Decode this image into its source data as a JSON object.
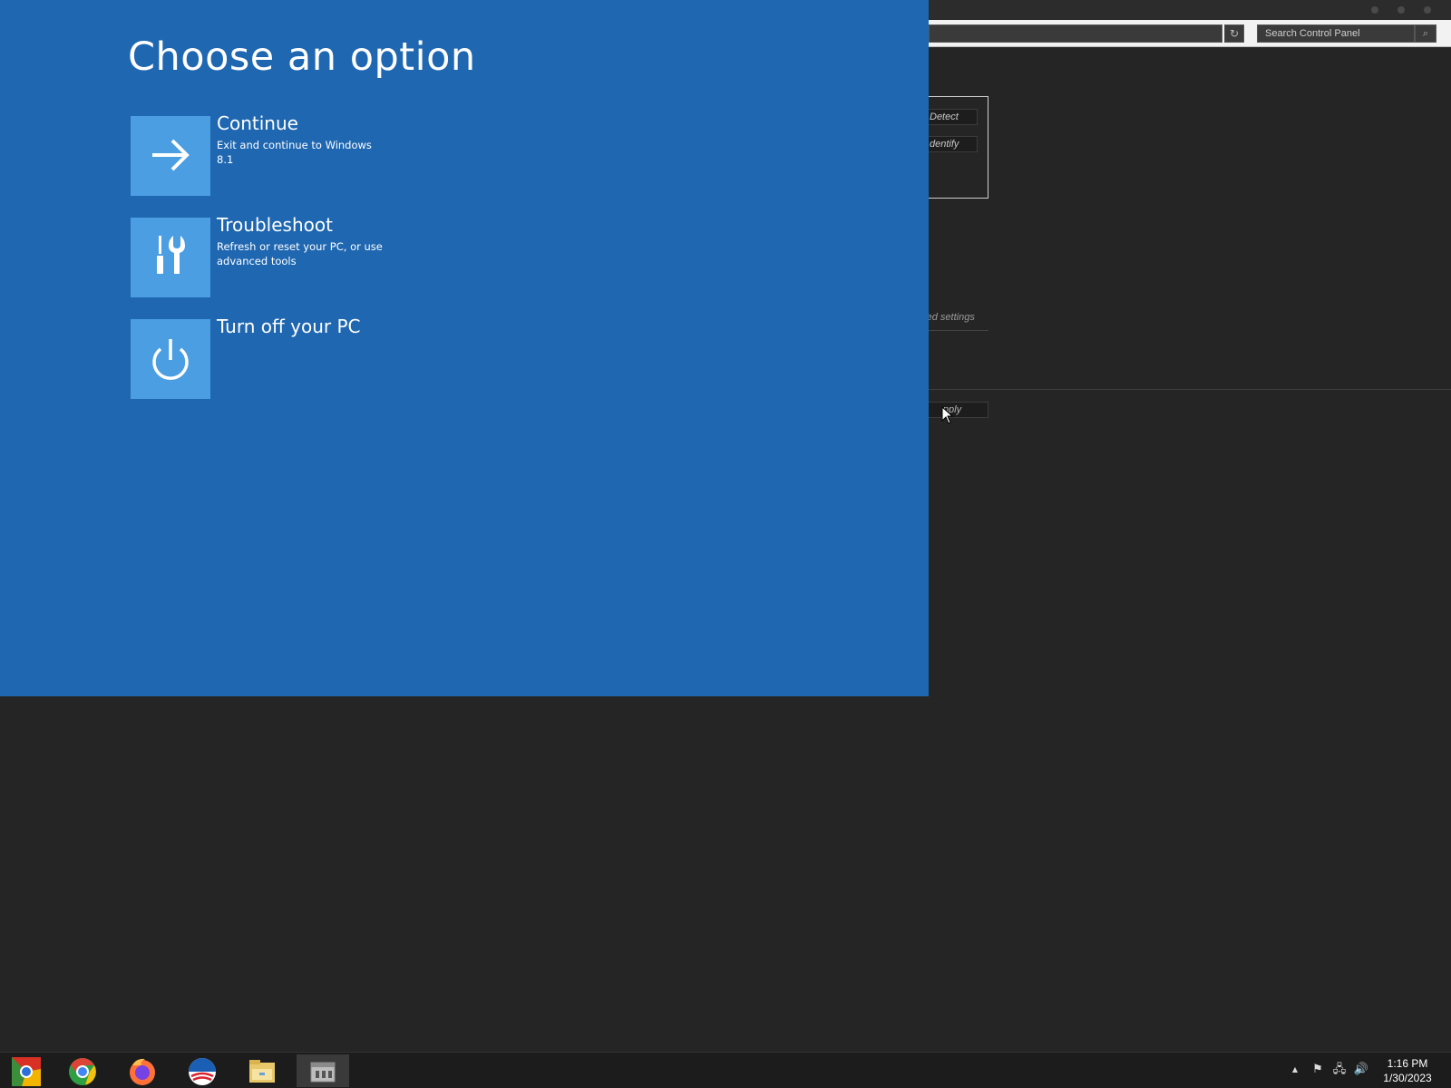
{
  "control_panel": {
    "search_placeholder": "Search Control Panel",
    "refresh_glyph": "↻",
    "search_glyph": "⌕",
    "detect_label": "Detect",
    "identify_label": "dentify",
    "advanced_settings_label": "nced settings",
    "apply_label": "pply"
  },
  "overlay": {
    "title": "Choose an option",
    "background_color": "#1f67b1",
    "tile_color": "#4b9ee2",
    "options": [
      {
        "title": "Continue",
        "description": "Exit and continue to Windows 8.1",
        "icon": "arrow-right-icon"
      },
      {
        "title": "Troubleshoot",
        "description": "Refresh or reset your PC, or use advanced tools",
        "icon": "tools-icon"
      },
      {
        "title": "Turn off your PC",
        "description": "",
        "icon": "power-icon"
      }
    ]
  },
  "taskbar": {
    "apps": [
      {
        "name": "chrome-dev-icon"
      },
      {
        "name": "chrome-icon"
      },
      {
        "name": "firefox-icon"
      },
      {
        "name": "obama-logo-icon"
      },
      {
        "name": "file-explorer-icon"
      },
      {
        "name": "control-panel-icon",
        "active": true
      }
    ],
    "tray": {
      "show_hidden_glyph": "▲",
      "flag_glyph": "⚑",
      "network_glyph": "🖧",
      "volume_glyph": "🔊"
    },
    "time": "1:16 PM",
    "date": "1/30/2023"
  }
}
